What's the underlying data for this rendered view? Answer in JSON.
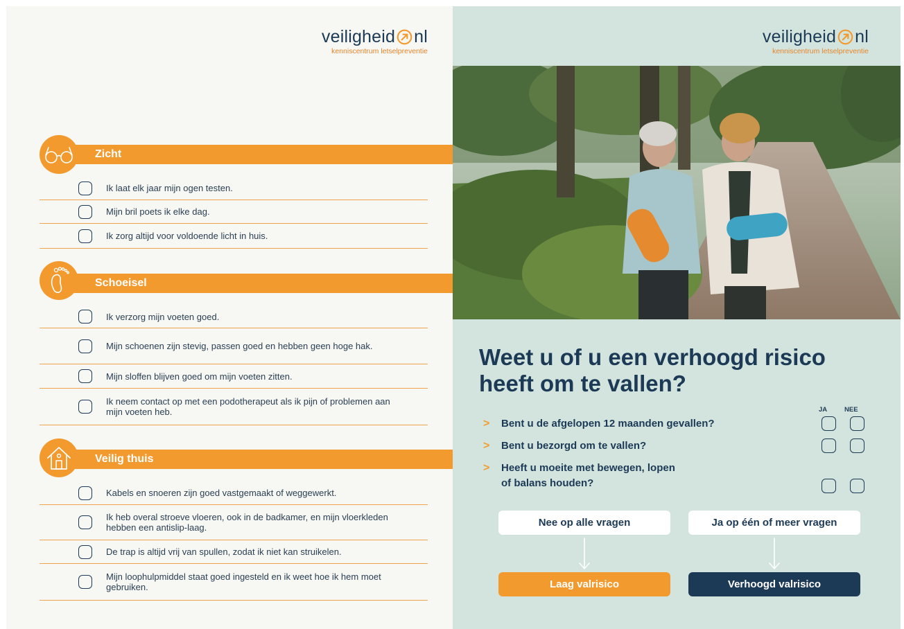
{
  "logo": {
    "left": {
      "word_left": "veiligheid",
      "word_right": "nl",
      "tagline": "kenniscentrum letselpreventie"
    },
    "right": {
      "word_left": "veiligheid",
      "word_right": "nl",
      "tagline": "kenniscentrum letselpreventie"
    }
  },
  "sections": [
    {
      "title": "Zicht",
      "icon": "glasses-icon",
      "items": [
        "Ik laat elk jaar mijn ogen testen.",
        "Mijn bril poets ik elke dag.",
        "Ik zorg altijd voor voldoende licht in huis."
      ]
    },
    {
      "title": "Schoeisel",
      "icon": "foot-icon",
      "items": [
        "Ik verzorg mijn voeten goed.",
        "Mijn schoenen zijn stevig, passen goed en hebben geen hoge hak.",
        "Mijn sloffen blijven goed om mijn voeten zitten.",
        "Ik neem contact op met een podotherapeut als ik pijn of problemen aan mijn voeten heb."
      ]
    },
    {
      "title": "Veilig thuis",
      "icon": "house-icon",
      "items": [
        "Kabels en snoeren zijn goed vastgemaakt of weggewerkt.",
        "Ik heb overal stroeve vloeren, ook in de badkamer, en mijn vloerkleden hebben een antislip-laag.",
        "De trap is altijd vrij van spullen, zodat ik niet kan struikelen.",
        "Mijn loophulpmiddel staat goed ingesteld en ik weet hoe ik hem moet gebruiken."
      ]
    }
  ],
  "quiz": {
    "headline": "Weet u of u een verhoogd risico heeft om te vallen?",
    "col_yes": "JA",
    "col_no": "NEE",
    "questions": [
      "Bent u de afgelopen 12 maanden gevallen?",
      "Bent u bezorgd om te vallen?",
      "Heeft u moeite met bewegen, lopen of balans houden?"
    ],
    "answer_no": "Nee op alle vragen",
    "answer_yes": "Ja op één of meer vragen",
    "result_low": "Laag valrisico",
    "result_high": "Verhoogd valrisico"
  },
  "colors": {
    "orange": "#f39a2e",
    "navy": "#1c3a55",
    "mint": "#d3e4df"
  }
}
